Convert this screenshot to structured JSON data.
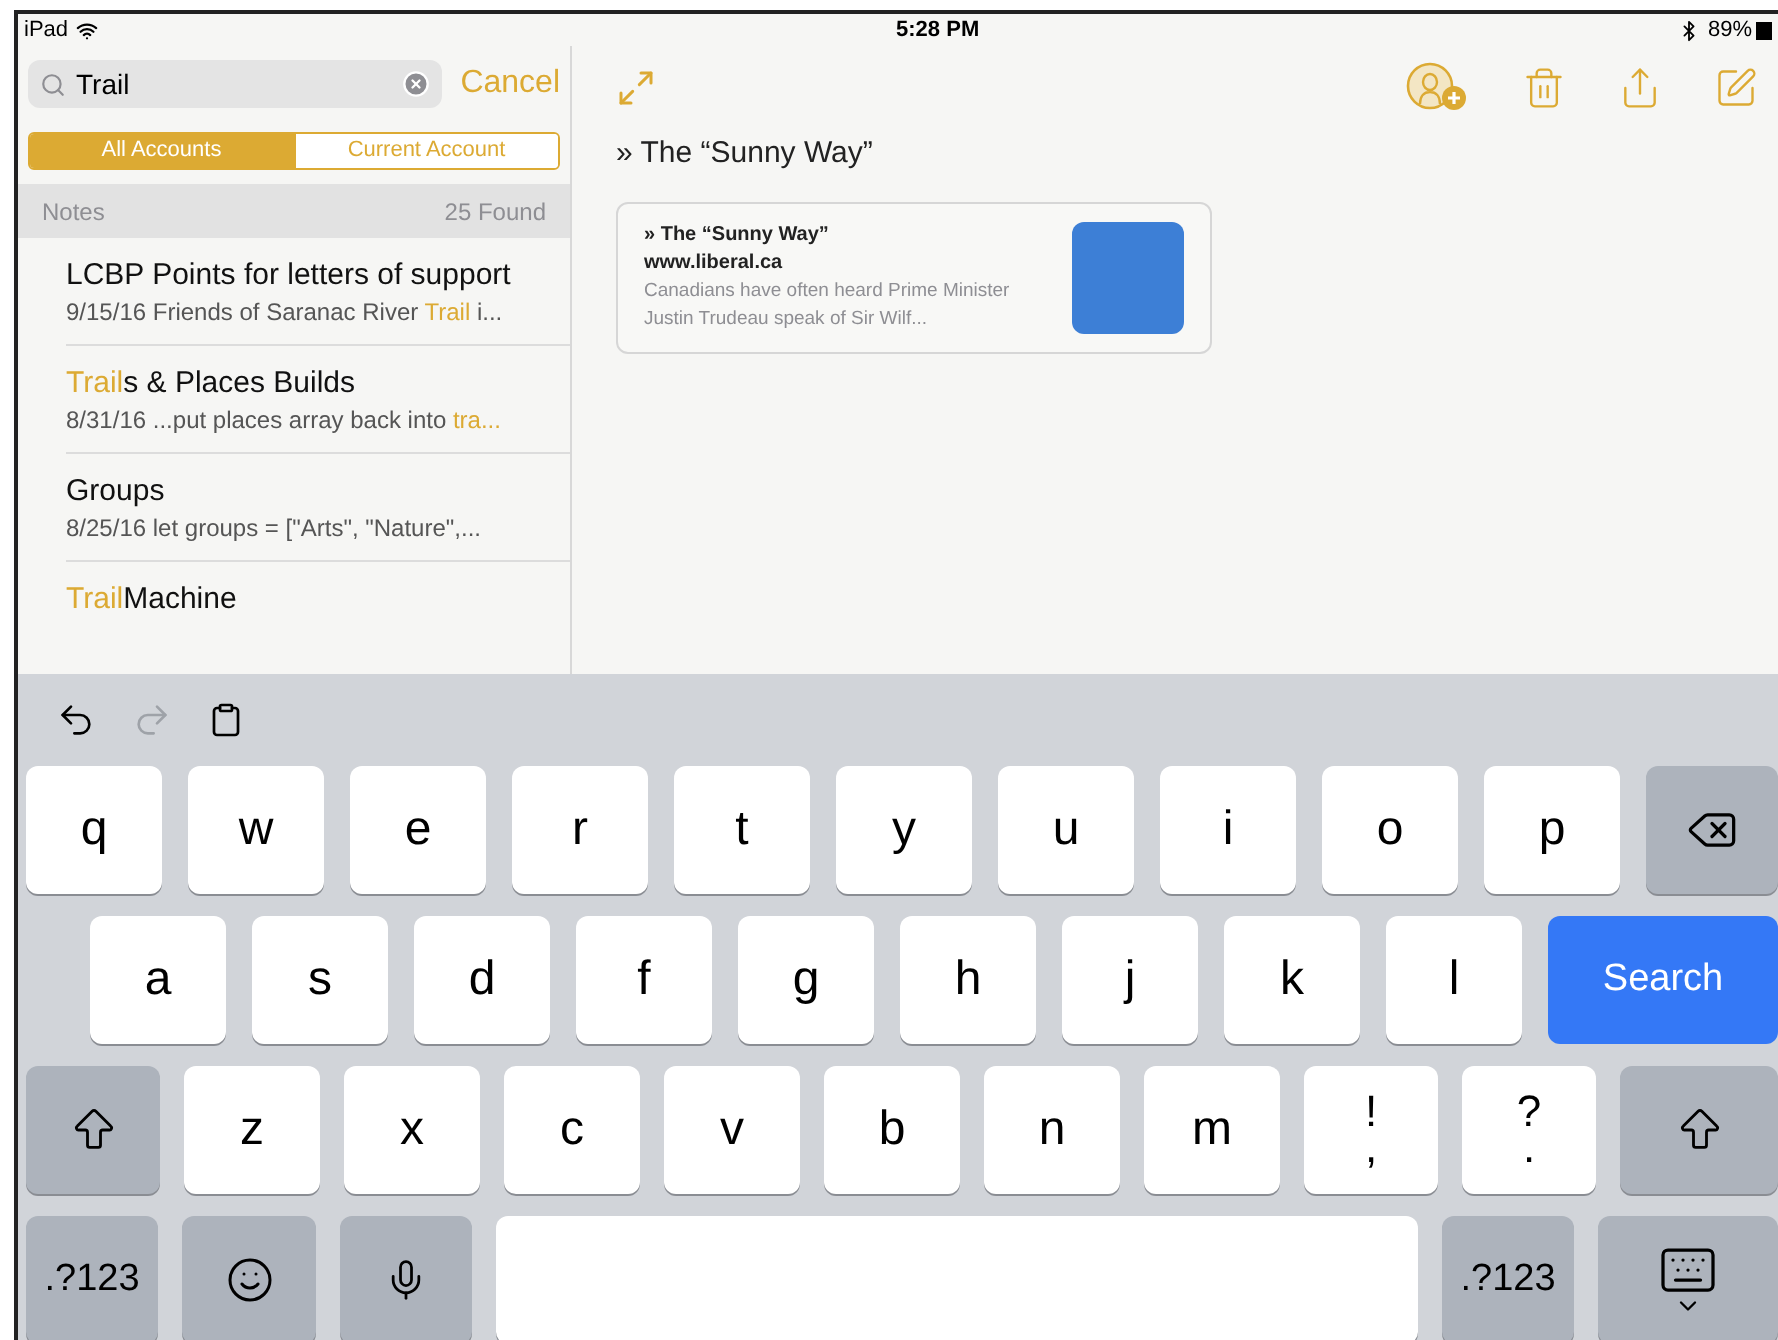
{
  "status_bar": {
    "device": "iPad",
    "time": "5:28 PM",
    "battery": "89%"
  },
  "sidebar": {
    "search": {
      "value": "Trail",
      "cancel": "Cancel"
    },
    "scopes": [
      {
        "label": "All Accounts",
        "selected": true
      },
      {
        "label": "Current Account",
        "selected": false
      }
    ],
    "section": {
      "title": "Notes",
      "count": "25 Found"
    },
    "notes": [
      {
        "title": [
          {
            "text": "LCBP Points for letters of support",
            "match": false
          }
        ],
        "date": "9/15/16",
        "snippet": [
          {
            "text": "Friends of Saranac River ",
            "match": false
          },
          {
            "text": "Trail",
            "match": true
          },
          {
            "text": " i...",
            "match": false
          }
        ]
      },
      {
        "title": [
          {
            "text": "Trail",
            "match": true
          },
          {
            "text": "s & Places Builds",
            "match": false
          }
        ],
        "date": "8/31/16",
        "snippet": [
          {
            "text": "...put places array back into ",
            "match": false
          },
          {
            "text": "tra...",
            "match": true
          }
        ]
      },
      {
        "title": [
          {
            "text": "Groups",
            "match": false
          }
        ],
        "date": "8/25/16",
        "snippet": [
          {
            "text": "let groups = [\"Arts\", \"Nature\",...",
            "match": false
          }
        ]
      },
      {
        "title": [
          {
            "text": "Trail",
            "match": true
          },
          {
            "text": "Machine",
            "match": false
          }
        ]
      }
    ]
  },
  "note": {
    "heading": "» The “Sunny Way”",
    "link_card": {
      "title": "» The “Sunny Way”",
      "site": "www.liberal.ca",
      "excerpt": "Canadians have often heard Prime Minister Justin Trudeau speak of Sir Wilf..."
    }
  },
  "keyboard": {
    "rows": [
      [
        {
          "kind": "letter",
          "label": "q"
        },
        {
          "kind": "letter",
          "label": "w"
        },
        {
          "kind": "letter",
          "label": "e"
        },
        {
          "kind": "letter",
          "label": "r"
        },
        {
          "kind": "letter",
          "label": "t"
        },
        {
          "kind": "letter",
          "label": "y"
        },
        {
          "kind": "letter",
          "label": "u"
        },
        {
          "kind": "letter",
          "label": "i"
        },
        {
          "kind": "letter",
          "label": "o"
        },
        {
          "kind": "letter",
          "label": "p"
        },
        {
          "kind": "backspace"
        }
      ],
      [
        {
          "kind": "letter",
          "label": "a"
        },
        {
          "kind": "letter",
          "label": "s"
        },
        {
          "kind": "letter",
          "label": "d"
        },
        {
          "kind": "letter",
          "label": "f"
        },
        {
          "kind": "letter",
          "label": "g"
        },
        {
          "kind": "letter",
          "label": "h"
        },
        {
          "kind": "letter",
          "label": "j"
        },
        {
          "kind": "letter",
          "label": "k"
        },
        {
          "kind": "letter",
          "label": "l"
        },
        {
          "kind": "search",
          "label": "Search"
        }
      ],
      [
        {
          "kind": "shift"
        },
        {
          "kind": "letter",
          "label": "z"
        },
        {
          "kind": "letter",
          "label": "x"
        },
        {
          "kind": "letter",
          "label": "c"
        },
        {
          "kind": "letter",
          "label": "v"
        },
        {
          "kind": "letter",
          "label": "b"
        },
        {
          "kind": "letter",
          "label": "n"
        },
        {
          "kind": "letter",
          "label": "m"
        },
        {
          "kind": "dual",
          "top": "!",
          "bottom": ","
        },
        {
          "kind": "dual",
          "top": "?",
          "bottom": "."
        },
        {
          "kind": "shift"
        }
      ],
      [
        {
          "kind": "numbers",
          "label": ".?123"
        },
        {
          "kind": "emoji"
        },
        {
          "kind": "mic"
        },
        {
          "kind": "space"
        },
        {
          "kind": "numbers",
          "label": ".?123"
        },
        {
          "kind": "dismiss"
        }
      ]
    ]
  }
}
